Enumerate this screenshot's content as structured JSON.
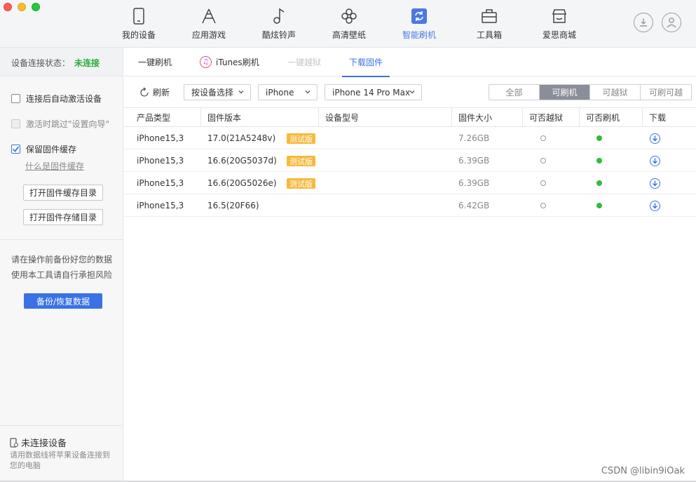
{
  "nav": {
    "items": [
      {
        "label": "我的设备",
        "icon": "phone-icon"
      },
      {
        "label": "应用游戏",
        "icon": "app-store-icon"
      },
      {
        "label": "酷炫铃声",
        "icon": "music-note-icon"
      },
      {
        "label": "高清壁纸",
        "icon": "flower-icon"
      },
      {
        "label": "智能刷机",
        "icon": "refresh-icon",
        "active": true
      },
      {
        "label": "工具箱",
        "icon": "toolbox-icon"
      },
      {
        "label": "爱思商城",
        "icon": "store-icon"
      }
    ],
    "accent": "#4a79e3"
  },
  "sidebar": {
    "conn_label": "设备连接状态：",
    "conn_value": "未连接",
    "opt_auto_activate": "连接后自动激活设备",
    "opt_skip_wizard": "激活时跳过\"设置向导\"",
    "opt_keep_cache": "保留固件缓存",
    "what_is_cache": "什么是固件缓存",
    "btn_open_cache_dir": "打开固件缓存目录",
    "btn_open_store_dir": "打开固件存储目录",
    "warn_line1": "请在操作前备份好您的数据",
    "warn_line2": "使用本工具请自行承担风险",
    "backup_btn": "备份/恢复数据",
    "nodev_title": "未连接设备",
    "nodev_desc": "请用数据线将苹果设备连接到您的电脑"
  },
  "tabs": [
    {
      "label": "一键刷机"
    },
    {
      "label": "iTunes刷机"
    },
    {
      "label": "一键越狱",
      "disabled": true
    },
    {
      "label": "下载固件",
      "active": true
    }
  ],
  "toolbar": {
    "refresh": "刷新",
    "select_mode": "按设备选择",
    "select_type": "iPhone",
    "select_model": "iPhone 14 Pro Max",
    "filters": [
      "全部",
      "可刷机",
      "可越狱",
      "可刷可越"
    ],
    "active_filter": "可刷机"
  },
  "table": {
    "headers": [
      "产品类型",
      "固件版本",
      "设备型号",
      "固件大小",
      "可否越狱",
      "可否刷机",
      "下载"
    ],
    "rows": [
      {
        "product": "iPhone15,3",
        "version": "17.0(21A5248v)",
        "badge": "测试版",
        "model": "",
        "size": "7.26GB",
        "jailbreak": false,
        "flash": true
      },
      {
        "product": "iPhone15,3",
        "version": "16.6(20G5037d)",
        "badge": "测试版",
        "model": "",
        "size": "6.39GB",
        "jailbreak": false,
        "flash": true
      },
      {
        "product": "iPhone15,3",
        "version": "16.6(20G5026e)",
        "badge": "测试版",
        "model": "",
        "size": "6.39GB",
        "jailbreak": false,
        "flash": true
      },
      {
        "product": "iPhone15,3",
        "version": "16.5(20F66)",
        "badge": "",
        "model": "",
        "size": "6.42GB",
        "jailbreak": false,
        "flash": true
      }
    ]
  },
  "watermark": "CSDN @libin9iOak"
}
